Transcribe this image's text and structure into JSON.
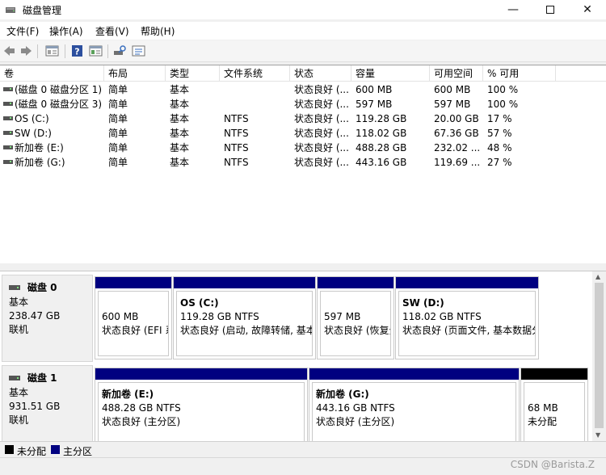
{
  "window": {
    "title": "磁盘管理"
  },
  "menu": [
    "文件(F)",
    "操作(A)",
    "查看(V)",
    "帮助(H)"
  ],
  "toolbar_icons": [
    "back-arrow-icon",
    "forward-arrow-icon",
    "properties-icon",
    "help-icon",
    "console-tree-icon",
    "rescan-icon",
    "list-view-icon"
  ],
  "table": {
    "headers": [
      "卷",
      "布局",
      "类型",
      "文件系统",
      "状态",
      "容量",
      "可用空间",
      "% 可用"
    ],
    "rows": [
      [
        "(磁盘 0 磁盘分区 1)",
        "简单",
        "基本",
        "",
        "状态良好 (...",
        "600 MB",
        "600 MB",
        "100 %"
      ],
      [
        "(磁盘 0 磁盘分区 3)",
        "简单",
        "基本",
        "",
        "状态良好 (...",
        "597 MB",
        "597 MB",
        "100 %"
      ],
      [
        "OS (C:)",
        "简单",
        "基本",
        "NTFS",
        "状态良好 (...",
        "119.28 GB",
        "20.00 GB",
        "17 %"
      ],
      [
        "SW (D:)",
        "简单",
        "基本",
        "NTFS",
        "状态良好 (...",
        "118.02 GB",
        "67.36 GB",
        "57 %"
      ],
      [
        "新加卷 (E:)",
        "简单",
        "基本",
        "NTFS",
        "状态良好 (...",
        "488.28 GB",
        "232.02 ...",
        "48 %"
      ],
      [
        "新加卷 (G:)",
        "简单",
        "基本",
        "NTFS",
        "状态良好 (...",
        "443.16 GB",
        "119.69 ...",
        "27 %"
      ]
    ]
  },
  "disks": [
    {
      "name": "磁盘 0",
      "type": "基本",
      "size": "238.47 GB",
      "status": "联机",
      "partitions": [
        {
          "title": "",
          "size": "600 MB",
          "status": "状态良好 (EFI 系统分区)"
        },
        {
          "title": "OS  (C:)",
          "size": "119.28 GB NTFS",
          "status": "状态良好 (启动, 故障转储, 基本数据分区)"
        },
        {
          "title": "",
          "size": "597 MB",
          "status": "状态良好 (恢复分区)"
        },
        {
          "title": "SW  (D:)",
          "size": "118.02 GB NTFS",
          "status": "状态良好 (页面文件, 基本数据分区)"
        }
      ]
    },
    {
      "name": "磁盘 1",
      "type": "基本",
      "size": "931.51 GB",
      "status": "联机",
      "partitions": [
        {
          "title": "新加卷  (E:)",
          "size": "488.28 GB NTFS",
          "status": "状态良好 (主分区)"
        },
        {
          "title": "新加卷  (G:)",
          "size": "443.16 GB NTFS",
          "status": "状态良好 (主分区)"
        },
        {
          "title": "",
          "size": "68 MB",
          "status": "未分配"
        }
      ]
    }
  ],
  "legend": {
    "unallocated": "未分配",
    "primary": "主分区",
    "unallocated_color": "#000000",
    "primary_color": "#000080"
  },
  "watermark": "CSDN @Barista.Z"
}
